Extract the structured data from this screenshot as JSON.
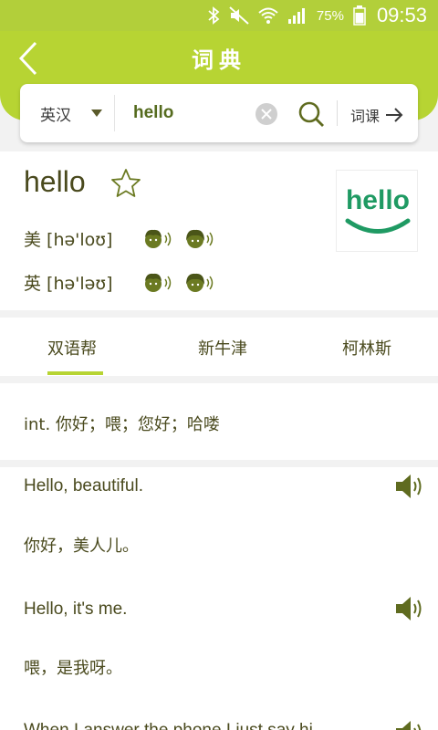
{
  "status_bar": {
    "battery_percent": "75%",
    "time": "09:53",
    "icons": [
      "bluetooth-icon",
      "mute-icon",
      "wifi-icon",
      "signal-icon",
      "battery-icon"
    ]
  },
  "header": {
    "title": "词典",
    "back_icon": "chevron-left-icon"
  },
  "search": {
    "language": "英汉",
    "query": "hello",
    "lesson_label": "词课",
    "icons": [
      "dropdown-arrow-icon",
      "clear-icon",
      "search-icon",
      "arrow-right-icon"
    ]
  },
  "word": {
    "headword": "hello",
    "logo_text": "hello",
    "pronunciations": [
      {
        "label": "美 [hə'loʊ]"
      },
      {
        "label": "英 [hə'ləʊ]"
      }
    ]
  },
  "tabs": [
    {
      "label": "双语帮",
      "active": true
    },
    {
      "label": "新牛津",
      "active": false
    },
    {
      "label": "柯林斯",
      "active": false
    }
  ],
  "definition": "int. 你好；喂；您好；哈喽",
  "examples": [
    {
      "en": "Hello, beautiful.",
      "zh": "你好，美人儿。"
    },
    {
      "en": "Hello, it's me.",
      "zh": "喂，是我呀。"
    },
    {
      "en": "When I answer the phone I just say hi",
      "zh": ""
    }
  ],
  "colors": {
    "brand_green": "#b7d433",
    "text_olive": "#4a4a1e",
    "icon_olive": "#5f6b1f",
    "logo_green": "#1f9a63"
  }
}
